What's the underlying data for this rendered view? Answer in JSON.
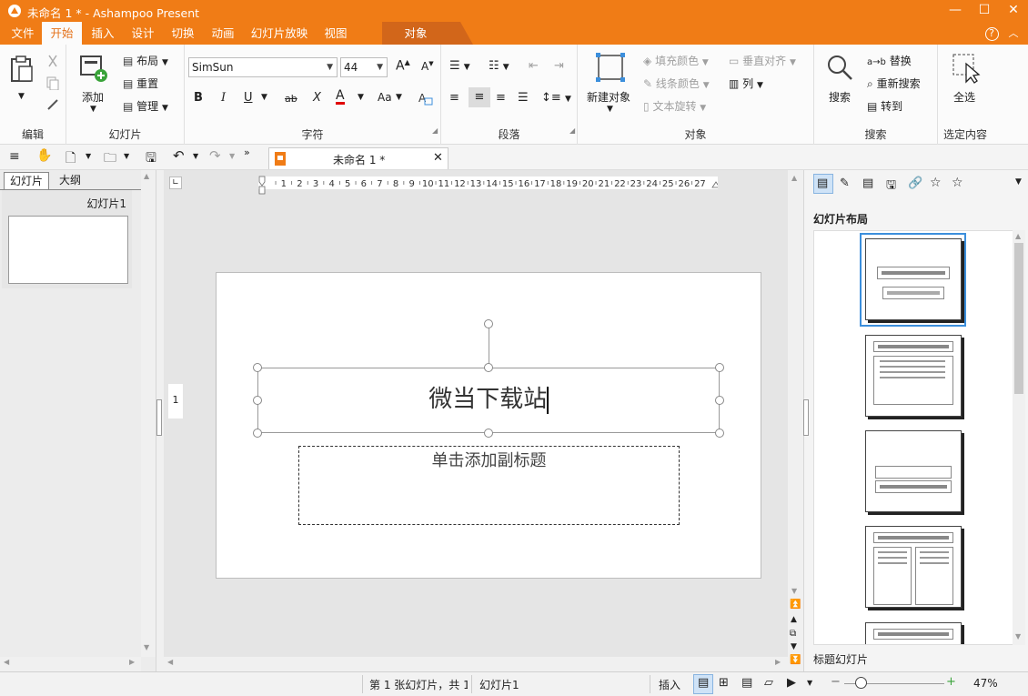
{
  "window": {
    "title": "未命名 1 * - Ashampoo Present",
    "minimize": "—",
    "maximize": "☐",
    "close": "✕"
  },
  "menu": {
    "items": [
      "文件",
      "开始",
      "插入",
      "设计",
      "切换",
      "动画",
      "幻灯片放映",
      "视图"
    ],
    "active": "开始",
    "context_tab": "对象",
    "help": "?"
  },
  "ribbon": {
    "groups": {
      "edit": "编辑",
      "slides": "幻灯片",
      "font": "字符",
      "paragraph": "段落",
      "object": "对象",
      "search": "搜索",
      "select": "选定内容"
    },
    "slides": {
      "add": "添加",
      "layout": "布局",
      "reset": "重置",
      "manage": "管理"
    },
    "font": {
      "family": "SimSun",
      "size": "44",
      "bold": "B",
      "italic": "I",
      "underline": "U",
      "strike": "ab",
      "clear": "X",
      "color": "A",
      "case": "Aa",
      "grow": "A",
      "shrink": "A"
    },
    "object": {
      "new_object": "新建对象",
      "fill_color": "填充颜色",
      "line_color": "线条颜色",
      "text_rotate": "文本旋转",
      "vertical_align": "垂直对齐",
      "columns": "列"
    },
    "search": {
      "search": "搜索",
      "replace": "替换",
      "research": "重新搜索",
      "goto": "转到"
    },
    "select": {
      "select_all": "全选"
    }
  },
  "document_tab": {
    "title": "未命名 1 *"
  },
  "left_panel": {
    "tabs": [
      "幻灯片",
      "大纲"
    ],
    "active_tab": "幻灯片",
    "thumbnails": [
      {
        "label": "幻灯片1"
      }
    ]
  },
  "ruler": {
    "ticks": [
      "1",
      "2",
      "3",
      "4",
      "5",
      "6",
      "7",
      "8",
      "9",
      "10",
      "11",
      "12",
      "13",
      "14",
      "15",
      "16",
      "17",
      "18",
      "19",
      "20",
      "21",
      "22",
      "23",
      "24",
      "25",
      "26",
      "27"
    ]
  },
  "slide": {
    "number_marker": "1",
    "title": "微当下载站",
    "subtitle_placeholder": "单击添加副标题"
  },
  "right_panel": {
    "heading": "幻灯片布局",
    "selected_layout": "标题幻灯片"
  },
  "status": {
    "slide_info": "第 1 张幻灯片，共 1",
    "slide_name": "幻灯片1",
    "insert_mode": "插入",
    "zoom": "47%",
    "minus": "−",
    "plus": "+"
  },
  "colors": {
    "accent": "#f07c16",
    "selection_blue": "#3c8fdc",
    "font_color_red": "#e00000"
  }
}
